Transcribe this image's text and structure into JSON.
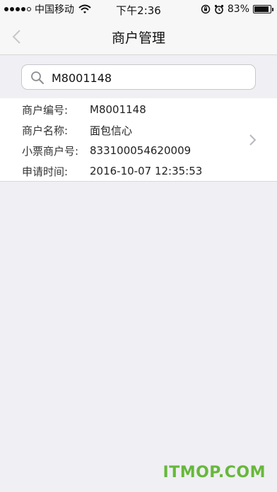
{
  "status_bar": {
    "carrier": "中国移动",
    "time": "下午2:36",
    "battery": "83%",
    "battery_level": 0.83
  },
  "nav": {
    "title": "商户管理"
  },
  "search": {
    "value": "M8001148"
  },
  "merchant": {
    "fields": [
      {
        "label": "商户编号:",
        "value": "M8001148"
      },
      {
        "label": "商户名称:",
        "value": "面包信心"
      },
      {
        "label": "小票商户号:",
        "value": "833100054620009"
      },
      {
        "label": "申请时间:",
        "value": "2016-10-07 12:35:53"
      }
    ]
  },
  "watermark": "ITMOP.COM",
  "colors": {
    "background": "#efeff4",
    "bar": "#f7f7f7",
    "watermark": "#67b83a"
  }
}
